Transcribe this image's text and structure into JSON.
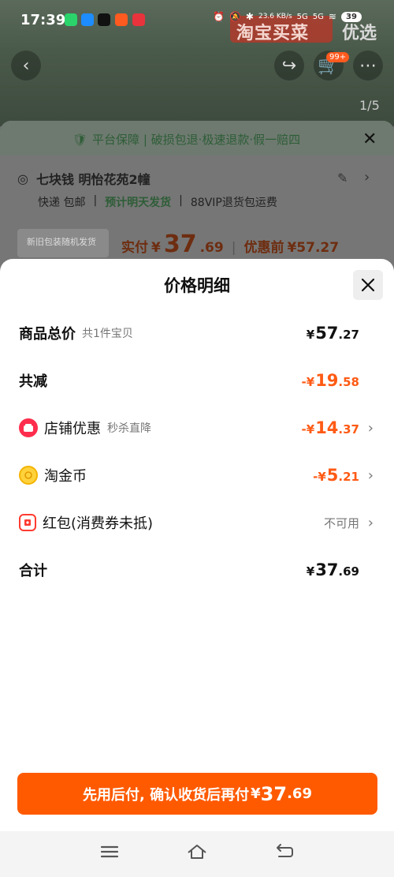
{
  "status_bar": {
    "time": "17:39",
    "net_speed": "23.6 KB/s",
    "net1": "5G",
    "net2": "5G",
    "battery": "39"
  },
  "background": {
    "banner": "淘宝买菜",
    "tab": "优选",
    "cart_badge": "99+",
    "pager": "1/5"
  },
  "back_sheet": {
    "guarantee": "平台保障 | 破损包退·极速退款·假一赔四",
    "address": "七块钱 明怡花苑2幢",
    "ship_method": "快递 包邮",
    "ship_time": "预计明天发货",
    "vip": "88VIP退货包运费",
    "promo_label": "新旧包装随机发货",
    "paid_label": "实付",
    "paid_yen": "¥",
    "paid_int": "37",
    "paid_dec": ".69",
    "before_label": "优惠前",
    "before_value": "¥57.27"
  },
  "sheet": {
    "title": "价格明细",
    "rows": {
      "total": {
        "label": "商品总价",
        "sub": "共1件宝贝",
        "yen": "¥",
        "int": "57",
        "dec": ".27"
      },
      "reduce": {
        "label": "共减",
        "neg": "-",
        "yen": "¥",
        "int": "19",
        "dec": ".58"
      },
      "shop": {
        "label": "店铺优惠",
        "sub": "秒杀直降",
        "neg": "-",
        "yen": "¥",
        "int": "14",
        "dec": ".37"
      },
      "coin": {
        "label": "淘金币",
        "neg": "-",
        "yen": "¥",
        "int": "5",
        "dec": ".21"
      },
      "redpack": {
        "label": "红包(消费券未抵)",
        "status": "不可用"
      },
      "sum": {
        "label": "合计",
        "yen": "¥",
        "int": "37",
        "dec": ".69"
      }
    },
    "cta": {
      "text": "先用后付, 确认收货后再付",
      "yen": "¥",
      "int": "37",
      "dec": ".69"
    }
  },
  "colors": {
    "accent": "#ff5a00",
    "discount": "#ff5a14"
  }
}
